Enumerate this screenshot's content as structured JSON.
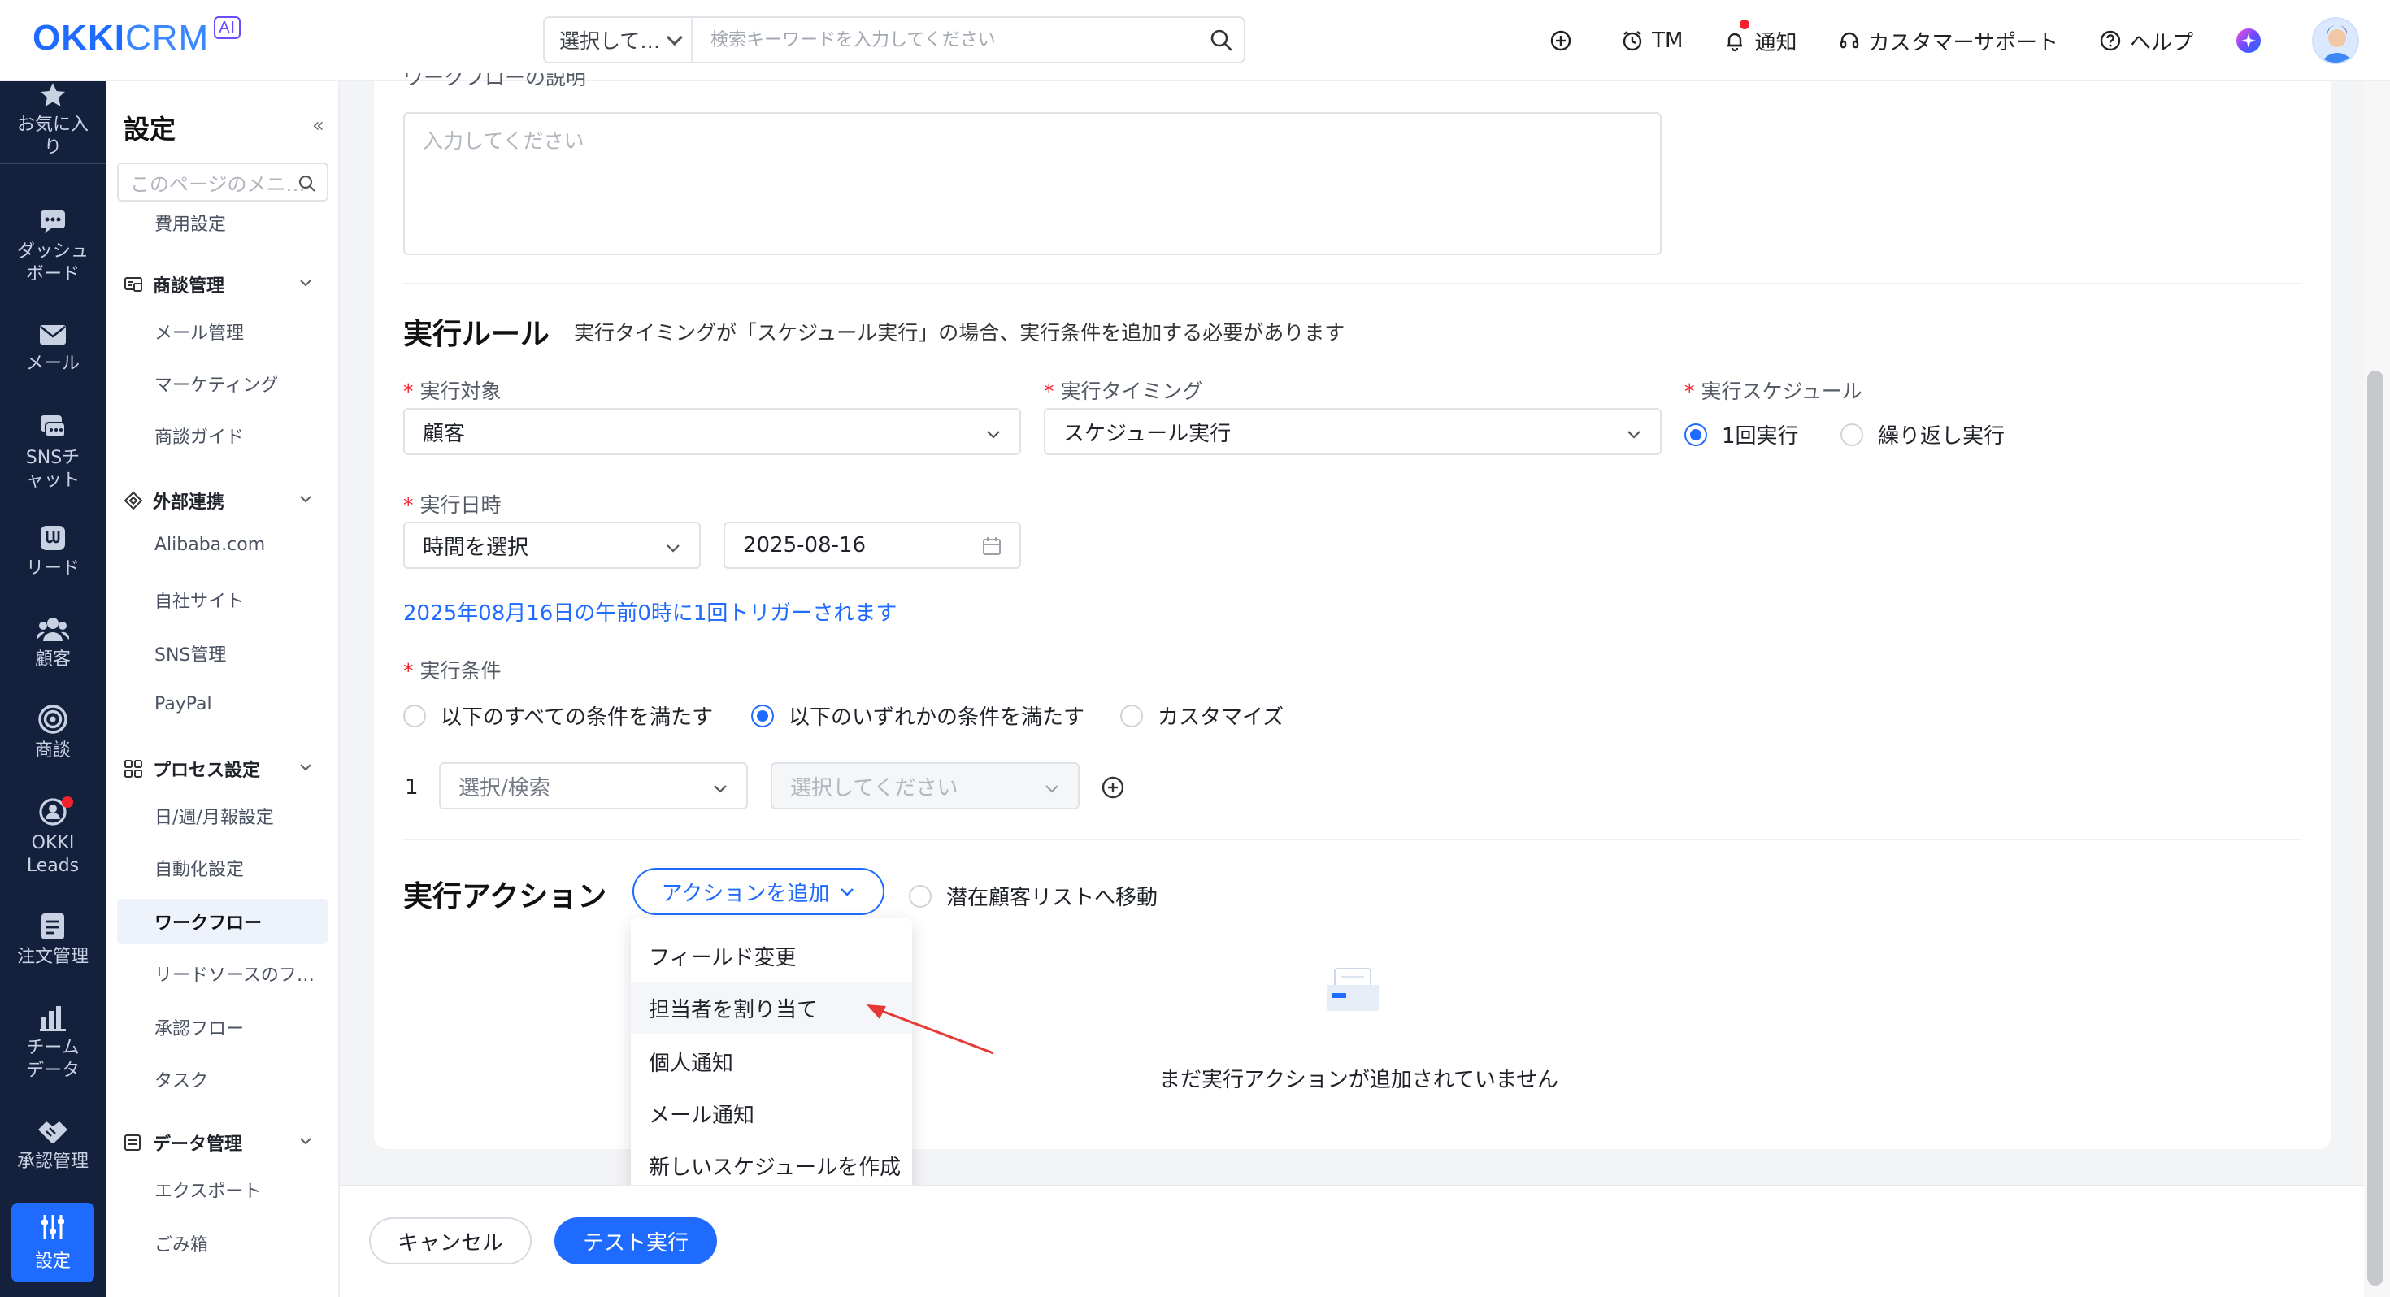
{
  "colors": {
    "brand": "#1f6bff",
    "nav_bg": "#14213d",
    "required": "#f5222d",
    "arrow": "#e53935"
  },
  "header": {
    "logo_main": "OKKI",
    "logo_sub": "CRM",
    "logo_badge": "AI",
    "search_select": "選択して…",
    "search_placeholder": "検索キーワードを入力してください",
    "actions": {
      "add_icon": "plus-circle-icon",
      "tm": "TM",
      "notify": "通知",
      "support": "カスタマーサポート",
      "help": "ヘルプ"
    }
  },
  "leftnav": [
    {
      "id": "favorites",
      "label": "お気に入り",
      "icon": "star-icon"
    },
    {
      "id": "dashboard",
      "label": "ダッシュボード",
      "icon": "dashboard-icon"
    },
    {
      "id": "mail",
      "label": "メール",
      "icon": "mail-icon"
    },
    {
      "id": "sns",
      "label": "SNSチャット",
      "icon": "chat-icon"
    },
    {
      "id": "leads",
      "label": "リード",
      "icon": "leads-icon"
    },
    {
      "id": "customers",
      "label": "顧客",
      "icon": "customers-icon"
    },
    {
      "id": "deals",
      "label": "商談",
      "icon": "target-icon"
    },
    {
      "id": "okki-leads",
      "label": "OKKI Leads",
      "icon": "okki-leads-icon"
    },
    {
      "id": "orders",
      "label": "注文管理",
      "icon": "orders-icon"
    },
    {
      "id": "team-data",
      "label": "チームデータ",
      "icon": "chart-icon"
    },
    {
      "id": "approval",
      "label": "承認管理",
      "icon": "handshake-icon"
    },
    {
      "id": "settings",
      "label": "設定",
      "icon": "settings-sliders-icon"
    }
  ],
  "settings_menu": {
    "title": "設定",
    "collapse": "«",
    "search_placeholder": "このページのメニ…",
    "top_link": "費用設定",
    "groups": [
      {
        "title": "商談管理",
        "items": [
          "メール管理",
          "マーケティング",
          "商談ガイド"
        ]
      },
      {
        "title": "外部連携",
        "items": [
          "Alibaba.com",
          "自社サイト",
          "SNS管理",
          "PayPal"
        ]
      },
      {
        "title": "プロセス設定",
        "items": [
          "日/週/月報設定",
          "自動化設定",
          "ワークフロー",
          "リードソースのフ…",
          "承認フロー",
          "タスク"
        ]
      },
      {
        "title": "データ管理",
        "items": [
          "エクスポート",
          "ごみ箱"
        ]
      }
    ]
  },
  "form": {
    "desc_label": "ワークフローの説明",
    "desc_placeholder": "入力してください",
    "rules_title": "実行ルール",
    "rules_note": "実行タイミングが「スケジュール実行」の場合、実行条件を追加する必要があります",
    "target_label": "実行対象",
    "target_value": "顧客",
    "timing_label": "実行タイミング",
    "timing_value": "スケジュール実行",
    "schedule_label": "実行スケジュール",
    "schedule_once": "1回実行",
    "schedule_repeat": "繰り返し実行",
    "datetime_label": "実行日時",
    "time_select": "時間を選択",
    "date_value": "2025-08-16",
    "trigger_note": "2025年08月16日の午前0時に1回トリガーされます",
    "condition_label": "実行条件",
    "cond_all": "以下のすべての条件を満たす",
    "cond_any": "以下のいずれかの条件を満たす",
    "cond_custom": "カスタマイズ",
    "cond_row_index": "1",
    "cond_field": "選択/検索",
    "cond_value_placeholder": "選択してください",
    "actions_title": "実行アクション",
    "add_action": "アクションを追加",
    "move_to_pool": "潜在顧客リストへ移動",
    "action_menu": [
      "フィールド変更",
      "担当者を割り当て",
      "個人通知",
      "メール通知",
      "新しいスケジュールを作成"
    ],
    "empty_text": "まだ実行アクションが追加されていません"
  },
  "footer": {
    "cancel": "キャンセル",
    "test_run": "テスト実行"
  }
}
